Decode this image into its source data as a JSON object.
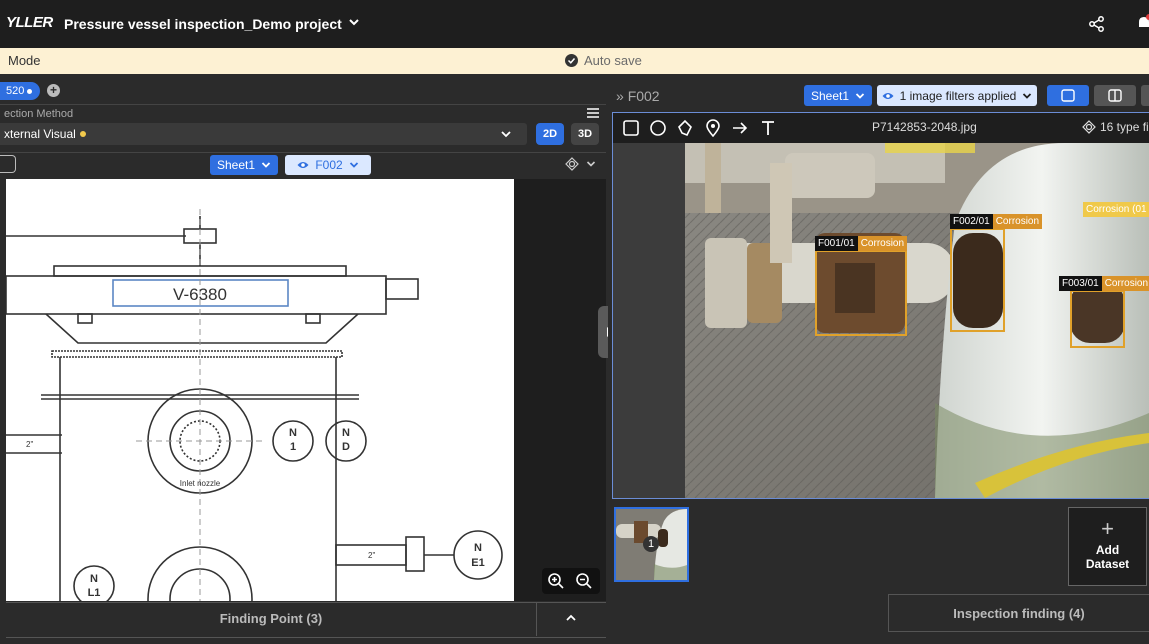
{
  "header": {
    "logo_text": "YLLER",
    "project_title": "Pressure vessel inspection_Demo project",
    "icons": [
      "chevron-down-icon",
      "share-icon",
      "bell-icon"
    ]
  },
  "modebar": {
    "mode_label": "Mode",
    "autosave_label": "Auto save"
  },
  "left_panel": {
    "tab_label": "520",
    "inspection_method_label": "ection Method",
    "inspection_method_value": "xternal Visual",
    "view_2d": "2D",
    "view_3d": "3D",
    "sheet_label": "Sheet1",
    "filter_label": "F002",
    "drawing": {
      "tag": "V-6380",
      "nozzles": [
        {
          "line1": "N",
          "line2": "1"
        },
        {
          "line1": "N",
          "line2": "D"
        },
        {
          "line1": "N",
          "line2": "E1"
        },
        {
          "line1": "N",
          "line2": "L1"
        }
      ],
      "caption": "Inlet nozzle",
      "dim_1": "2\"",
      "dim_2": "2\""
    },
    "footer_label": "Finding Point (3)"
  },
  "right_panel": {
    "breadcrumb": "F002",
    "sheet_label": "Sheet1",
    "filters_label": "1 image filters applied",
    "image_name": "P7142853-2048.jpg",
    "type_filter_label": "16 type filt",
    "detections": [
      {
        "id": "F001/01",
        "class": "Corrosion"
      },
      {
        "id": "F002/01",
        "class": "Corrosion"
      },
      {
        "id": "F003/01",
        "class": "Corrosion"
      },
      {
        "id": "",
        "class": "Corrosion (01"
      }
    ],
    "thumbnail_badge": "1",
    "add_dataset_label_1": "Add",
    "add_dataset_label_2": "Dataset",
    "add_dataset_plus": "+",
    "inspection_finding_label": "Inspection finding (4)"
  },
  "colors": {
    "accent": "#2f6fe0",
    "detection_box": "#e0a12a",
    "mode_bar": "#fdf1d3"
  }
}
